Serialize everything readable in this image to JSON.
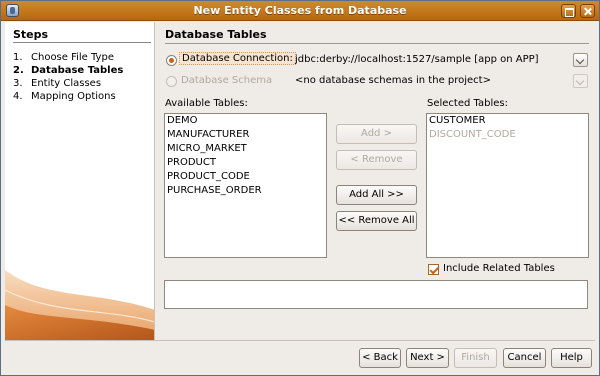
{
  "window": {
    "title": "New Entity Classes from Database"
  },
  "steps": {
    "heading": "Steps",
    "items": [
      {
        "number": "1.",
        "label": "Choose File Type",
        "current": false
      },
      {
        "number": "2.",
        "label": "Database Tables",
        "current": true
      },
      {
        "number": "3.",
        "label": "Entity Classes",
        "current": false
      },
      {
        "number": "4.",
        "label": "Mapping Options",
        "current": false
      }
    ]
  },
  "panel": {
    "title": "Database Tables",
    "connection": {
      "label": "Database Connection:",
      "value": "jdbc:derby://localhost:1527/sample [app on APP]",
      "selected": true
    },
    "schema": {
      "label": "Database Schema",
      "value": "<no database schemas in the project>",
      "enabled": false
    },
    "available": {
      "label": "Available Tables:",
      "items": [
        "DEMO",
        "MANUFACTURER",
        "MICRO_MARKET",
        "PRODUCT",
        "PRODUCT_CODE",
        "PURCHASE_ORDER"
      ]
    },
    "selected": {
      "label": "Selected Tables:",
      "items": [
        {
          "label": "CUSTOMER",
          "enabled": true
        },
        {
          "label": "DISCOUNT_CODE",
          "enabled": false
        }
      ]
    },
    "buttons": {
      "add": "Add >",
      "remove": "< Remove",
      "add_all": "Add All >>",
      "remove_all": "<< Remove All"
    },
    "include_related": {
      "label": "Include Related Tables",
      "checked": true
    },
    "message": ""
  },
  "footer": {
    "back": "< Back",
    "next": "Next >",
    "finish": "Finish",
    "cancel": "Cancel",
    "help": "Help"
  },
  "colors": {
    "title_bar": "#c27818",
    "accent": "#c2651a",
    "disabled_text": "#b0a9a0"
  }
}
